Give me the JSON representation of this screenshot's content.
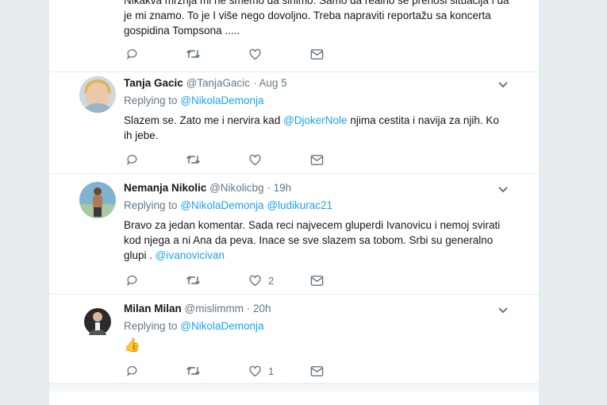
{
  "prev_tweet": {
    "line1": "Nikakva mržnja mi ne smemo da šinimo. Samo da realno se prenosi situacija i da",
    "line2": "je mi znamo. To je I više nego dovoljno. Treba napraviti reportažu sa koncerta",
    "line3": "gospidina Tompsona ....."
  },
  "tweets": [
    {
      "name": "Tanja Gacic",
      "handle": "@TanjaGacic",
      "dot": "·",
      "time": "Aug 5",
      "replying_prefix": "Replying to",
      "replying_to": "@NikolaDemonja",
      "replying_to2": "",
      "text_a": "Slazem se.  Zato me i nervira kad ",
      "mention": "@DjokerNole",
      "text_b": " njima cestita i navija za njih.  Ko",
      "text_c": "ih jebe.",
      "like_count": ""
    },
    {
      "name": "Nemanja Nikolic",
      "handle": "@Nikolicbg",
      "dot": "·",
      "time": "19h",
      "replying_prefix": "Replying to",
      "replying_to": "@NikolaDemonja",
      "replying_to2": "@ludikurac21",
      "line1": "Bravo za jedan komentar. Sada reci najvecem gluperdi Ivanovicu i nemoj svirati",
      "line2": "kod njega a ni Ana da peva. Inace se sve slazem sa tobom. Srbi su generalno",
      "line3": "glupi . ",
      "mention": "@ivanovicivan",
      "like_count": "2"
    },
    {
      "name": "Milan Milan",
      "handle": "@mislimmm",
      "dot": "·",
      "time": "20h",
      "replying_prefix": "Replying to",
      "replying_to": "@NikolaDemonja",
      "emoji": "👍",
      "like_count": "1"
    }
  ],
  "icons": [
    "reply-icon",
    "retweet-icon",
    "like-icon",
    "dm-icon",
    "chevron-down-icon"
  ],
  "colors": {
    "link": "#1da1f2",
    "muted": "#657786",
    "border": "#e6ecf0"
  }
}
